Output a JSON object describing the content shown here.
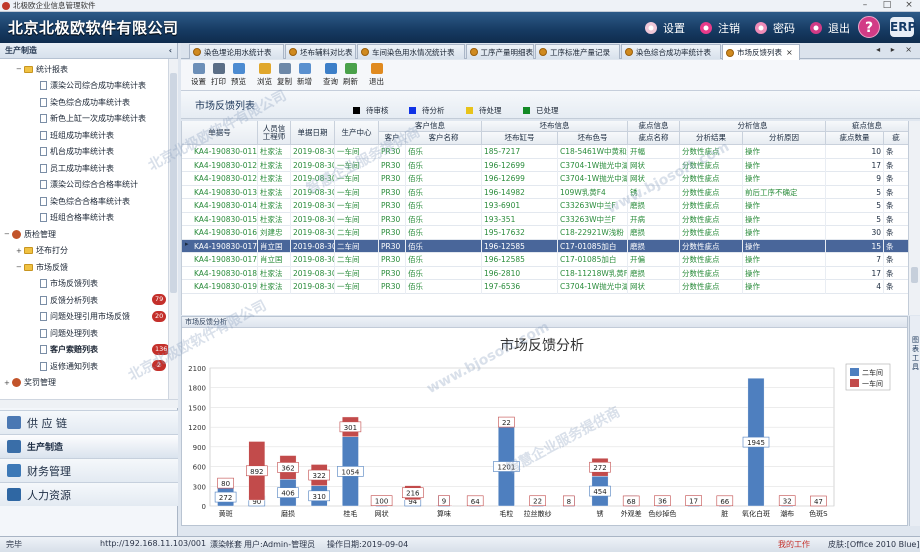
{
  "window": {
    "title": "北极欧企业信息管理软件"
  },
  "banner": {
    "brand": "北京北极欧软件有限公司",
    "actions": [
      {
        "label": "设置",
        "icon": "gear-icon",
        "color": "#f0c8d8"
      },
      {
        "label": "注销",
        "icon": "lock-icon",
        "color": "#e83b8a"
      },
      {
        "label": "密码",
        "icon": "key-icon",
        "color": "#f08cb8"
      },
      {
        "label": "退出",
        "icon": "power-icon",
        "color": "#d23b86"
      }
    ],
    "help": "?",
    "logo": "ERP"
  },
  "sidebar": {
    "header": "生产制造",
    "collapse": "‹",
    "tree": [
      {
        "label": "统计报表",
        "level": 1,
        "type": "folder",
        "toggle": "−"
      },
      {
        "label": "漂染公司综合成功率统计表",
        "level": 2,
        "type": "doc"
      },
      {
        "label": "染色综合成功率统计表",
        "level": 2,
        "type": "doc"
      },
      {
        "label": "新色上缸一次成功率统计表",
        "level": 2,
        "type": "doc"
      },
      {
        "label": "班组成功率统计表",
        "level": 2,
        "type": "doc"
      },
      {
        "label": "机台成功率统计表",
        "level": 2,
        "type": "doc"
      },
      {
        "label": "员工成功率统计表",
        "level": 2,
        "type": "doc"
      },
      {
        "label": "漂染公司综合合格率统计",
        "level": 2,
        "type": "doc"
      },
      {
        "label": "染色综合合格率统计表",
        "level": 2,
        "type": "doc"
      },
      {
        "label": "班组合格率统计表",
        "level": 2,
        "type": "doc"
      },
      {
        "label": "质检管理",
        "level": 0,
        "type": "gear",
        "toggle": "−"
      },
      {
        "label": "坯布打分",
        "level": 1,
        "type": "folder",
        "toggle": "+"
      },
      {
        "label": "市场反馈",
        "level": 1,
        "type": "folder",
        "toggle": "−"
      },
      {
        "label": "市场反馈列表",
        "level": 2,
        "type": "doc"
      },
      {
        "label": "反馈分析列表",
        "level": 2,
        "type": "doc",
        "badge": "79"
      },
      {
        "label": "问题处理引用市场反馈",
        "level": 2,
        "type": "doc",
        "badge": "20"
      },
      {
        "label": "问题处理列表",
        "level": 2,
        "type": "doc"
      },
      {
        "label": "客户索赔列表",
        "level": 2,
        "type": "doc",
        "badge": "136",
        "selected": true
      },
      {
        "label": "返修通知列表",
        "level": 2,
        "type": "doc",
        "badge": "2"
      },
      {
        "label": "奖罚管理",
        "level": 0,
        "type": "gear",
        "toggle": "+"
      }
    ],
    "modules": [
      {
        "label": "供 应 链",
        "color": "#4b78b3"
      },
      {
        "label": "生产制造",
        "color": "#3a6ea8",
        "active": true
      },
      {
        "label": "财务管理",
        "color": "#3d79b7"
      },
      {
        "label": "人力资源",
        "color": "#2f67a3"
      }
    ]
  },
  "tabs": [
    {
      "label": "染色埋论用水统计表"
    },
    {
      "label": "坯布辅料对比表"
    },
    {
      "label": "车间染色用水情况统计表"
    },
    {
      "label": "工序产量明细表"
    },
    {
      "label": "工序标准产量记录"
    },
    {
      "label": "染色综合成功率统计表"
    },
    {
      "label": "市场反馈列表",
      "active": true,
      "close": "×"
    }
  ],
  "tab_nav": "◂ ▸ ×",
  "toolbar": [
    {
      "label": "设置",
      "color": "#6c8fb8"
    },
    {
      "label": "打印",
      "color": "#5b6e86"
    },
    {
      "label": "预览",
      "color": "#4c8bd1"
    },
    {
      "sep": true
    },
    {
      "label": "浏览",
      "color": "#e0a72c"
    },
    {
      "label": "复制",
      "color": "#6d88a8"
    },
    {
      "label": "新增",
      "color": "#5a90cf"
    },
    {
      "sep": true
    },
    {
      "label": "查询",
      "color": "#3d7fc8"
    },
    {
      "label": "刷新",
      "color": "#4aa14a"
    },
    {
      "sep": true
    },
    {
      "label": "退出",
      "color": "#e08a1f"
    }
  ],
  "panel": {
    "title": "市场反馈列表",
    "statuses": [
      {
        "label": "待审核",
        "color": "#000000"
      },
      {
        "label": "待分析",
        "color": "#1033e6"
      },
      {
        "label": "待处理",
        "color": "#e8c31a"
      },
      {
        "label": "已处理",
        "color": "#138a26"
      }
    ]
  },
  "grid": {
    "headers": {
      "doc_no": "单据号",
      "person": "人员信\n工程师",
      "date": "单据日期",
      "center": "生产中心",
      "customer_group": "客户信息",
      "customer": "客户",
      "customer_name": "客户名称",
      "fabric_group": "坯布信息",
      "fabric_vat": "坯布缸号",
      "fabric_color": "坯布色号",
      "defect_group": "疵点信息",
      "defect_name": "疵点名称",
      "analysis_group": "分析信息",
      "result": "分析结果",
      "reason": "分析原因",
      "defect_qty_group": "疵点信息",
      "qty": "疵点数量",
      "unit": "疵"
    },
    "rows": [
      {
        "doc": "KA4-190830-011",
        "person": "杜家法",
        "date": "2019-08-30",
        "center": "一车间",
        "cust": "PR30",
        "cname": "佰乐",
        "vat": "185-7217",
        "color": "C18-5461W中黄和红",
        "defect": "开幅",
        "result": "分数性疵点",
        "reason": "操作",
        "qty": "10",
        "unit": "条"
      },
      {
        "doc": "KA4-190830-012",
        "person": "杜家法",
        "date": "2019-08-30",
        "center": "一车间",
        "cust": "PR30",
        "cname": "佰乐",
        "vat": "196-12699",
        "color": "C3704-1W抛光中湖",
        "defect": "网状",
        "result": "分数性疵点",
        "reason": "操作",
        "qty": "17",
        "unit": "条"
      },
      {
        "doc": "KA4-190830-012",
        "person": "杜家法",
        "date": "2019-08-30",
        "center": "一车间",
        "cust": "PR30",
        "cname": "佰乐",
        "vat": "196-12699",
        "color": "C3704-1W抛光中湖",
        "defect": "网状",
        "result": "分数性疵点",
        "reason": "操作",
        "qty": "9",
        "unit": "条"
      },
      {
        "doc": "KA4-190830-013",
        "person": "杜家法",
        "date": "2019-08-30",
        "center": "一车间",
        "cust": "PR30",
        "cname": "佰乐",
        "vat": "196-14982",
        "color": "109W乳黄F4",
        "defect": "锈",
        "result": "分数性疵点",
        "reason": "前后工序不确定",
        "qty": "5",
        "unit": "条"
      },
      {
        "doc": "KA4-190830-014",
        "person": "杜家法",
        "date": "2019-08-30",
        "center": "一车间",
        "cust": "PR30",
        "cname": "佰乐",
        "vat": "193-6901",
        "color": "C33263W中兰F",
        "defect": "磨损",
        "result": "分数性疵点",
        "reason": "操作",
        "qty": "5",
        "unit": "条"
      },
      {
        "doc": "KA4-190830-015",
        "person": "杜家法",
        "date": "2019-08-30",
        "center": "一车间",
        "cust": "PR30",
        "cname": "佰乐",
        "vat": "193-351",
        "color": "C33263W中兰F",
        "defect": "开病",
        "result": "分数性疵点",
        "reason": "操作",
        "qty": "5",
        "unit": "条"
      },
      {
        "doc": "KA4-190830-016",
        "person": "刘建忠",
        "date": "2019-08-30",
        "center": "二车间",
        "cust": "PR30",
        "cname": "佰乐",
        "vat": "195-17632",
        "color": "C18-22921W浅粉",
        "defect": "磨损",
        "result": "分数性疵点",
        "reason": "操作",
        "qty": "30",
        "unit": "条"
      },
      {
        "doc": "KA4-190830-017",
        "person": "肖立国",
        "date": "2019-08-30",
        "center": "二车间",
        "cust": "PR30",
        "cname": "佰乐",
        "vat": "196-12585",
        "color": "C17-01085加白",
        "defect": "磨损",
        "result": "分数性疵点",
        "reason": "操作",
        "qty": "15",
        "unit": "条",
        "selected": true
      },
      {
        "doc": "KA4-190830-017",
        "person": "肖立国",
        "date": "2019-08-30",
        "center": "二车间",
        "cust": "PR30",
        "cname": "佰乐",
        "vat": "196-12585",
        "color": "C17-01085加白",
        "defect": "开偏",
        "result": "分数性疵点",
        "reason": "操作",
        "qty": "7",
        "unit": "条"
      },
      {
        "doc": "KA4-190830-018",
        "person": "杜家法",
        "date": "2019-08-30",
        "center": "一车间",
        "cust": "PR30",
        "cname": "佰乐",
        "vat": "196-2810",
        "color": "C18-11218W乳黄F4",
        "defect": "磨损",
        "result": "分数性疵点",
        "reason": "操作",
        "qty": "17",
        "unit": "条"
      },
      {
        "doc": "KA4-190830-019",
        "person": "杜家法",
        "date": "2019-08-30",
        "center": "一车间",
        "cust": "PR30",
        "cname": "佰乐",
        "vat": "197-6536",
        "color": "C3704-1W抛光中湖",
        "defect": "网状",
        "result": "分数性疵点",
        "reason": "操作",
        "qty": "4",
        "unit": "条"
      }
    ]
  },
  "analysis": {
    "pane_title": "市场反馈分析",
    "side_tool": "图表工具"
  },
  "chart_data": {
    "type": "bar",
    "stacked": true,
    "title": "市场反馈分析",
    "ylim": [
      0,
      2100
    ],
    "yticks": [
      0,
      300,
      600,
      900,
      1200,
      1500,
      1800,
      2100
    ],
    "categories": [
      "黄斑",
      "",
      "磨损",
      "",
      "桂毛",
      "网状",
      "",
      "算味",
      "",
      "毛粒",
      "拉丝散纱",
      "",
      "锈",
      "外观差",
      "色纱掉色",
      "",
      "脏",
      "氧化白斑",
      "潮布",
      "色斑S"
    ],
    "series": [
      {
        "name": "二车间",
        "color": "#4e7fbf",
        "values": [
          272,
          90,
          406,
          310,
          1054,
          5,
          94,
          6,
          3,
          1201,
          4,
          2,
          454,
          1,
          4,
          6,
          3,
          1945,
          5,
          0
        ]
      },
      {
        "name": "一车间",
        "color": "#c24b4b",
        "values": [
          80,
          892,
          362,
          322,
          301,
          100,
          216,
          9,
          64,
          22,
          22,
          8,
          272,
          68,
          36,
          17,
          66,
          0,
          32,
          47
        ]
      }
    ],
    "legend_position": "top-right"
  },
  "status": {
    "left": "完毕",
    "url": "http://192.168.11.103/001",
    "dept": "漂染帐套",
    "user": "用户:Admin-管理员",
    "opdate": "操作日期:2019-09-04",
    "mywork": "我的工作",
    "skin": "皮肤:[Office 2010 Blue]"
  },
  "watermark": [
    "北京北极欧软件有限公司",
    "智慧企业服务提供商",
    "www.bjosoft.com"
  ]
}
